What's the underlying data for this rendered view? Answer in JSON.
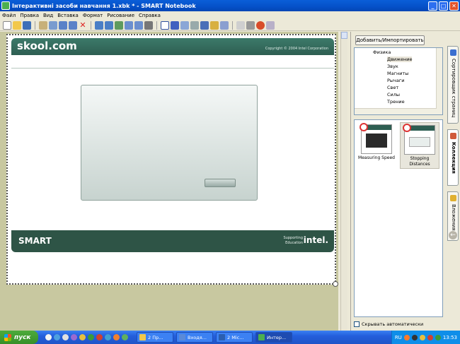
{
  "window": {
    "title": "Інтерактивні засоби навчання 1.xbk * - SMART Notebook"
  },
  "menu": [
    "Файл",
    "Правка",
    "Вид",
    "Вставка",
    "Формат",
    "Рисование",
    "Справка"
  ],
  "slide": {
    "brand": "skool.com",
    "copyright": "Copyright © 2004 Intel Corporation",
    "footer_logo": "SMART",
    "footer_tagline_1": "Supporting",
    "footer_tagline_2": "Education",
    "footer_intel": "intel."
  },
  "sidepanel": {
    "add_button": "Добавить/Импортировать",
    "tree": [
      "Физика",
      "Движение",
      "Звук",
      "Магниты",
      "Рычаги",
      "Свет",
      "Силы",
      "Трение"
    ],
    "gallery": [
      {
        "caption": "Measuring Speed"
      },
      {
        "caption": "Stopping Distances"
      }
    ],
    "autohide_label": "Скрывать автоматически"
  },
  "sidetabs": {
    "page_sorter": "Сортировщик страниц",
    "gallery": "Коллекция",
    "attachments": "Вложения"
  },
  "taskbar": {
    "start": "пуск",
    "tasks": [
      "2 Пр...",
      "Входя...",
      "2 Mic...",
      "Интер..."
    ],
    "lang": "RU",
    "time": "13:53"
  },
  "colors": {
    "skool_green": "#2e5e52",
    "canvas_bg": "#c8c8a0",
    "titlebar": "#0550c8"
  }
}
